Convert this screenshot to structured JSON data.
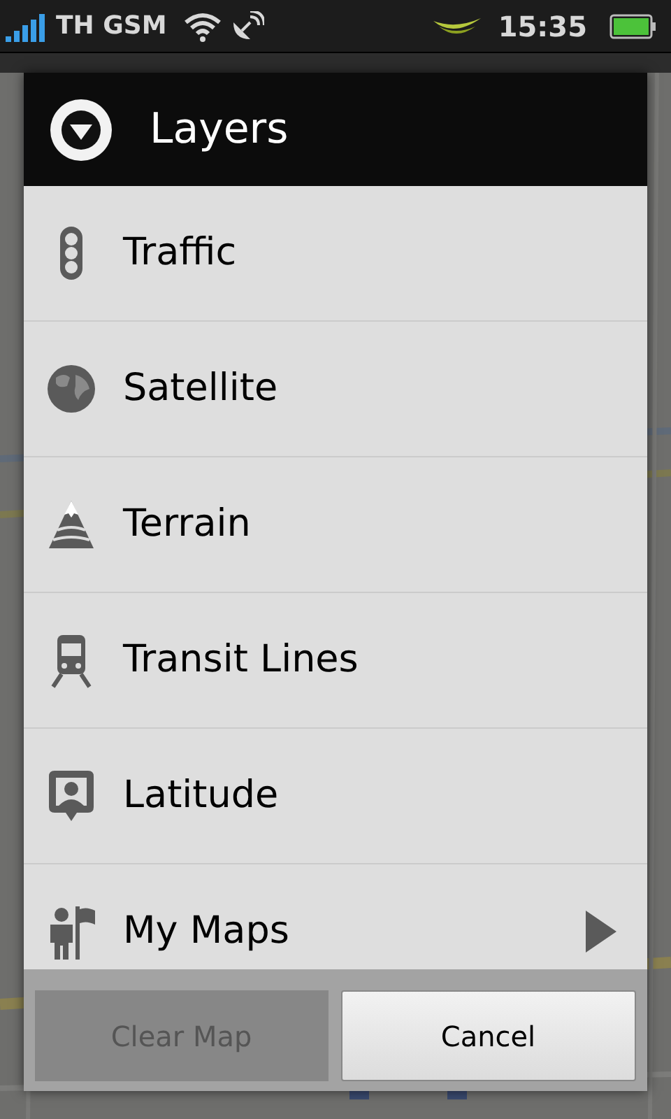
{
  "status_bar": {
    "carrier": "TH GSM",
    "time": "15:35"
  },
  "dialog": {
    "title": "Layers",
    "items": [
      {
        "label": "Traffic",
        "submenu": false
      },
      {
        "label": "Satellite",
        "submenu": false
      },
      {
        "label": "Terrain",
        "submenu": false
      },
      {
        "label": "Transit Lines",
        "submenu": false
      },
      {
        "label": "Latitude",
        "submenu": false
      },
      {
        "label": "My Maps",
        "submenu": true
      }
    ],
    "buttons": [
      {
        "label": "Clear Map",
        "disabled": true
      },
      {
        "label": "Cancel",
        "disabled": false
      }
    ]
  }
}
